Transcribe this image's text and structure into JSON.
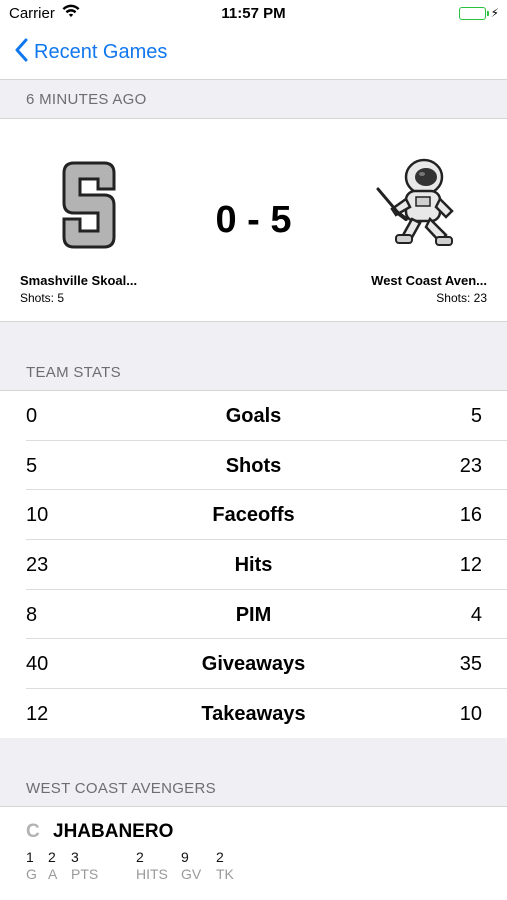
{
  "status_bar": {
    "carrier": "Carrier",
    "time": "11:57 PM"
  },
  "nav": {
    "back_label": "Recent Games"
  },
  "game": {
    "time_header": "6 MINUTES AGO",
    "score": "0 - 5",
    "home": {
      "name": "Smashville Skoal...",
      "shots": "Shots: 5",
      "logo_letter": "S"
    },
    "away": {
      "name": "West Coast Aven...",
      "shots": "Shots: 23"
    }
  },
  "team_stats": {
    "header": "TEAM STATS",
    "rows": [
      {
        "left": "0",
        "label": "Goals",
        "right": "5"
      },
      {
        "left": "5",
        "label": "Shots",
        "right": "23"
      },
      {
        "left": "10",
        "label": "Faceoffs",
        "right": "16"
      },
      {
        "left": "23",
        "label": "Hits",
        "right": "12"
      },
      {
        "left": "8",
        "label": "PIM",
        "right": "4"
      },
      {
        "left": "40",
        "label": "Giveaways",
        "right": "35"
      },
      {
        "left": "12",
        "label": "Takeaways",
        "right": "10"
      }
    ]
  },
  "roster": {
    "header": "WEST COAST AVENGERS",
    "player": {
      "position": "C",
      "name": "JHABANERO",
      "stats": [
        {
          "value": "1",
          "label": "G"
        },
        {
          "value": "2",
          "label": "A"
        },
        {
          "value": "3",
          "label": "PTS"
        },
        {
          "value": "2",
          "label": "HITS"
        },
        {
          "value": "9",
          "label": "GV"
        },
        {
          "value": "2",
          "label": "TK"
        }
      ]
    }
  },
  "colors": {
    "accent": "#1177ee",
    "battery": "#2bc03f",
    "section_bg": "#efeff4"
  }
}
